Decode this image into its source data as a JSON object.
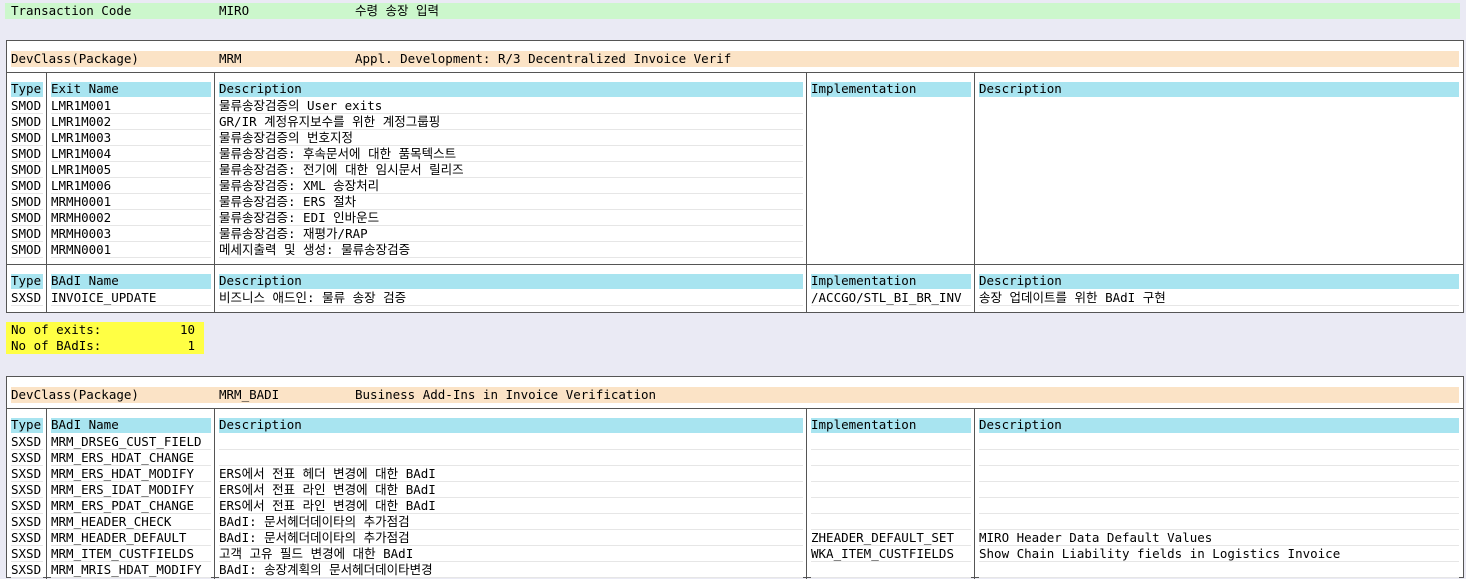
{
  "transaction": {
    "label": "Transaction Code",
    "code": "MIRO",
    "description": "수령 송장 입력"
  },
  "package1": {
    "label": "DevClass(Package)",
    "name": "MRM",
    "description": "Appl. Development: R/3 Decentralized Invoice Verif",
    "exits_header": {
      "type": "Type",
      "name": "Exit Name",
      "desc": "Description",
      "impl": "Implementation",
      "impl_desc": "Description"
    },
    "exits": [
      {
        "type": "SMOD",
        "name": "LMR1M001",
        "desc": "물류송장검증의 User exits"
      },
      {
        "type": "SMOD",
        "name": "LMR1M002",
        "desc": "GR/IR 계정유지보수를 위한 계정그룹핑"
      },
      {
        "type": "SMOD",
        "name": "LMR1M003",
        "desc": "물류송장검증의 번호지정"
      },
      {
        "type": "SMOD",
        "name": "LMR1M004",
        "desc": "물류송장검증: 후속문서에 대한 품목텍스트"
      },
      {
        "type": "SMOD",
        "name": "LMR1M005",
        "desc": "물류송장검증: 전기에 대한 임시문서 릴리즈"
      },
      {
        "type": "SMOD",
        "name": "LMR1M006",
        "desc": "물류송장검증: XML 송장처리"
      },
      {
        "type": "SMOD",
        "name": "MRMH0001",
        "desc": "물류송장검증: ERS 절차"
      },
      {
        "type": "SMOD",
        "name": "MRMH0002",
        "desc": "물류송장검증: EDI 인바운드"
      },
      {
        "type": "SMOD",
        "name": "MRMH0003",
        "desc": "물류송장검증: 재평가/RAP"
      },
      {
        "type": "SMOD",
        "name": "MRMN0001",
        "desc": "메세지출력 및 생성: 물류송장검증"
      }
    ],
    "badi_header": {
      "type": "Type",
      "name": "BAdI Name",
      "desc": "Description",
      "impl": "Implementation",
      "impl_desc": "Description"
    },
    "badis": [
      {
        "type": "SXSD",
        "name": "INVOICE_UPDATE",
        "desc": "비즈니스 애드인: 물류 송장 검증",
        "impl": "/ACCGO/STL_BI_BR_INV",
        "impl_desc": "송장 업데이트를 위한 BAdI 구현"
      }
    ]
  },
  "summary": {
    "exits_label": "No of exits:",
    "exits_count": "10",
    "badis_label": "No of BAdIs:",
    "badis_count": "1"
  },
  "package2": {
    "label": "DevClass(Package)",
    "name": "MRM_BADI",
    "description": "Business Add-Ins in Invoice Verification",
    "badi_header": {
      "type": "Type",
      "name": "BAdI Name",
      "desc": "Description",
      "impl": "Implementation",
      "impl_desc": "Description"
    },
    "badis": [
      {
        "type": "SXSD",
        "name": "MRM_DRSEG_CUST_FIELD",
        "desc": "",
        "impl": "",
        "impl_desc": ""
      },
      {
        "type": "SXSD",
        "name": "MRM_ERS_HDAT_CHANGE",
        "desc": "",
        "impl": "",
        "impl_desc": ""
      },
      {
        "type": "SXSD",
        "name": "MRM_ERS_HDAT_MODIFY",
        "desc": "ERS에서 전표 헤더 변경에 대한 BAdI",
        "impl": "",
        "impl_desc": ""
      },
      {
        "type": "SXSD",
        "name": "MRM_ERS_IDAT_MODIFY",
        "desc": "ERS에서 전표 라인 변경에 대한 BAdI",
        "impl": "",
        "impl_desc": ""
      },
      {
        "type": "SXSD",
        "name": "MRM_ERS_PDAT_CHANGE",
        "desc": "ERS에서 전표 라인 변경에 대한 BAdI",
        "impl": "",
        "impl_desc": ""
      },
      {
        "type": "SXSD",
        "name": "MRM_HEADER_CHECK",
        "desc": "BAdI: 문서헤더데이타의 추가점검",
        "impl": "",
        "impl_desc": ""
      },
      {
        "type": "SXSD",
        "name": "MRM_HEADER_DEFAULT",
        "desc": "BAdI: 문서헤더데이타의 추가점검",
        "impl": "ZHEADER_DEFAULT_SET",
        "impl_desc": "MIRO Header Data Default Values"
      },
      {
        "type": "SXSD",
        "name": "MRM_ITEM_CUSTFIELDS",
        "desc": "고객 고유 필드 변경에 대한 BAdI",
        "impl": "WKA_ITEM_CUSTFIELDS",
        "impl_desc": "Show Chain Liability fields in Logistics Invoice"
      },
      {
        "type": "SXSD",
        "name": "MRM_MRIS_HDAT_MODIFY",
        "desc": "BAdI: 송장계획의 문서헤더데이타변경",
        "impl": "",
        "impl_desc": ""
      }
    ]
  }
}
